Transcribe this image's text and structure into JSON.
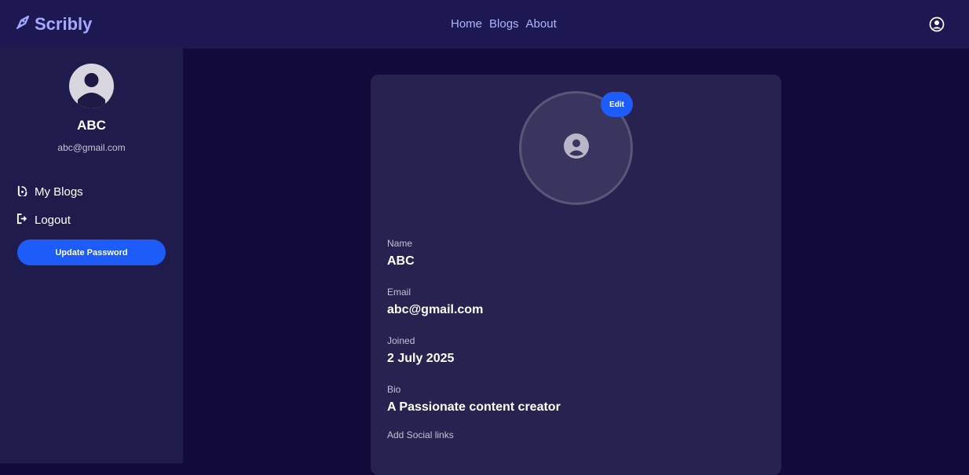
{
  "brand": {
    "name": "Scribly",
    "icon": "pen-nib-icon",
    "color": "#a3a9ff"
  },
  "nav": {
    "links": [
      {
        "label": "Home"
      },
      {
        "label": "Blogs"
      },
      {
        "label": "About"
      }
    ]
  },
  "header": {
    "user_icon": "user-circle-icon"
  },
  "sidebar": {
    "name": "ABC",
    "email": "abc@gmail.com",
    "menu": [
      {
        "label": "My Blogs",
        "icon": "blog-icon"
      },
      {
        "label": "Logout",
        "icon": "logout-icon"
      }
    ],
    "update_password_label": "Update Password"
  },
  "profile": {
    "edit_label": "Edit",
    "fields": [
      {
        "label": "Name",
        "value": "ABC"
      },
      {
        "label": "Email",
        "value": "abc@gmail.com"
      },
      {
        "label": "Joined",
        "value": "2 July 2025"
      },
      {
        "label": "Bio",
        "value": "A Passionate content creator"
      }
    ],
    "social_label": "Add Social links"
  },
  "colors": {
    "background": "#110a3a",
    "navbar": "#1d1851",
    "sidebar": "#201b4d",
    "card": "#27224f",
    "accent": "#1d5cf8"
  }
}
